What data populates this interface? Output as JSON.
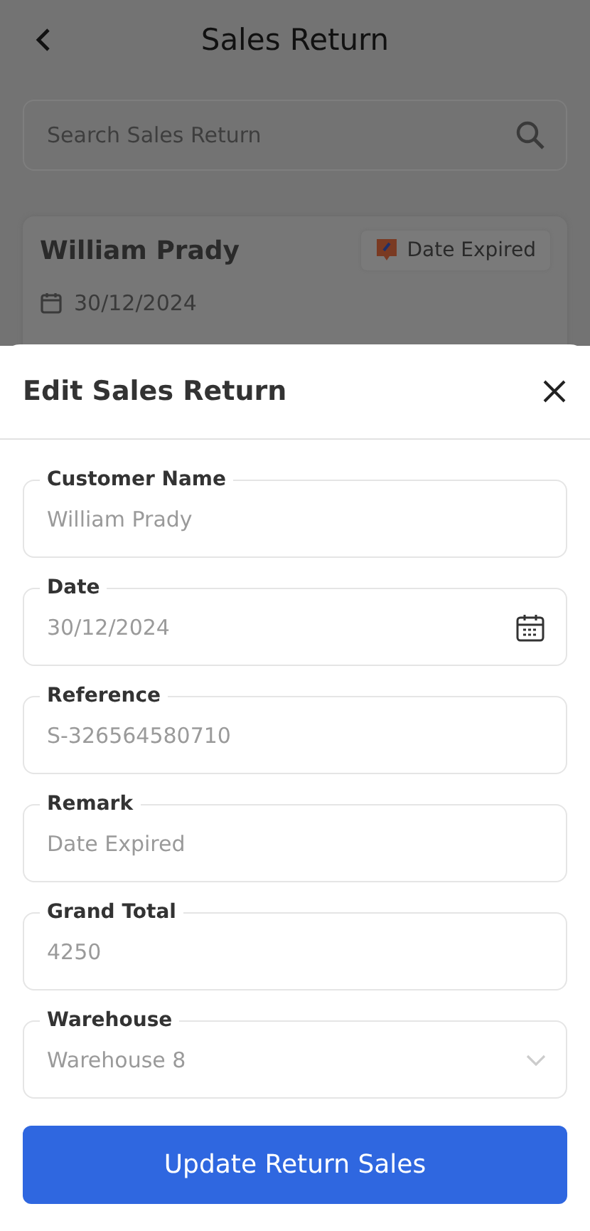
{
  "header": {
    "title": "Sales Return"
  },
  "search": {
    "placeholder": "Search Sales Return"
  },
  "record": {
    "customer": "William Prady",
    "status": "Date Expired",
    "date": "30/12/2024"
  },
  "sheet": {
    "title": "Edit Sales Return",
    "fields": [
      {
        "kind": "text",
        "label": "Customer Name",
        "value": "William Prady"
      },
      {
        "kind": "date",
        "label": "Date",
        "value": "30/12/2024"
      },
      {
        "kind": "text",
        "label": "Reference",
        "value": "S-326564580710"
      },
      {
        "kind": "text",
        "label": "Remark",
        "value": "Date Expired"
      },
      {
        "kind": "text",
        "label": "Grand Total",
        "value": "4250"
      },
      {
        "kind": "select",
        "label": "Warehouse",
        "value": "Warehouse 8"
      }
    ],
    "submit": "Update Return Sales"
  }
}
